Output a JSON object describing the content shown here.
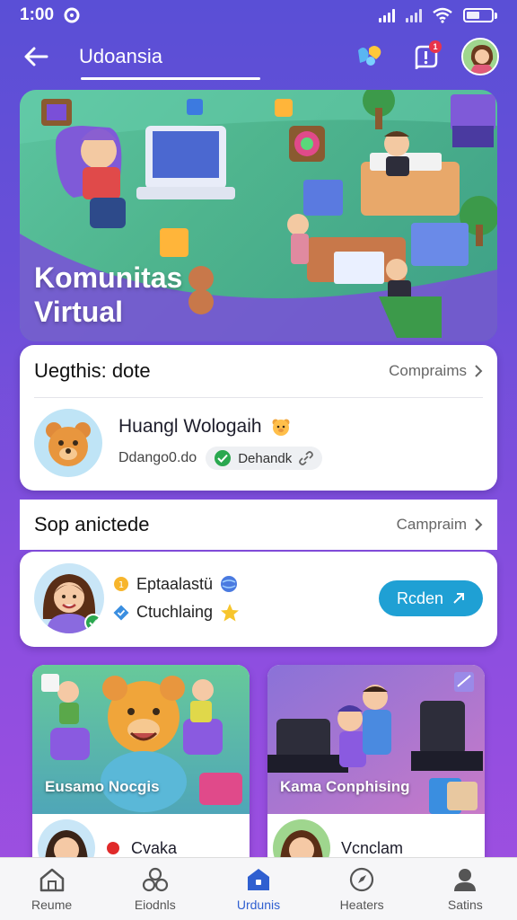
{
  "status_bar": {
    "time": "1:00",
    "battery": ""
  },
  "app_bar": {
    "title": "Udoansia",
    "notification_count": "1"
  },
  "hero": {
    "title_line1": "Komunitas",
    "title_line2": "Virtual"
  },
  "card1": {
    "title": "Uegthis: dote",
    "link": "Compraims",
    "user_name": "Huangl Wologaih",
    "user_handle": "Ddango0.do",
    "chip_label": "Dehandk"
  },
  "section2": {
    "title": "Sop anictede",
    "link": "Campraim"
  },
  "card2": {
    "line1": "Eptaalastü",
    "line2": "Ctuchlaing",
    "button_label": "Rcden"
  },
  "tiles": [
    {
      "caption": "Eusamo Nocgis",
      "user": "Cvaka"
    },
    {
      "caption": "Kama Conphising",
      "user": "Vcnclam"
    }
  ],
  "bottom_nav": [
    {
      "label": "Reume",
      "icon": "home-icon"
    },
    {
      "label": "Eiodnls",
      "icon": "community-icon"
    },
    {
      "label": "Urdunis",
      "icon": "house-badge-icon",
      "active": true
    },
    {
      "label": "Heaters",
      "icon": "compass-icon"
    },
    {
      "label": "Satins",
      "icon": "profile-icon"
    }
  ],
  "colors": {
    "accent": "#1fa0d4",
    "brand": "#5a4fd6",
    "active_nav": "#2f5fd0"
  }
}
